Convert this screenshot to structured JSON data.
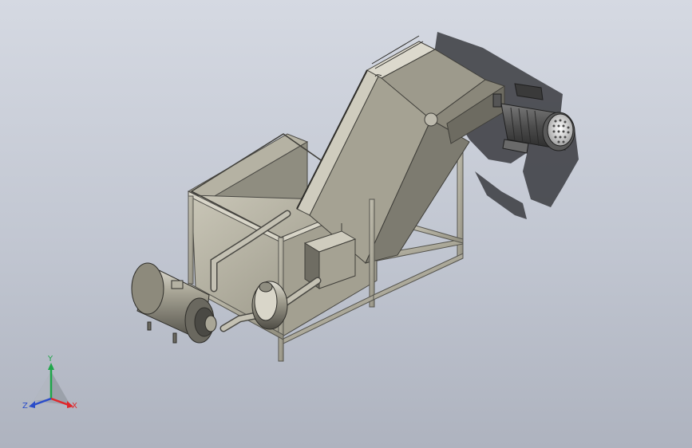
{
  "view": {
    "background_top": "#d5d9e2",
    "background_bottom": "#aeb3bf",
    "steel_color": "#a9a594",
    "steel_dark_color": "#6f6d63",
    "shadow_color": "#3a3b40"
  },
  "triad": {
    "x_label": "X",
    "y_label": "Y",
    "z_label": "Z",
    "x_color": "#e0262a",
    "y_color": "#1fa64a",
    "z_color": "#2a4cc9"
  }
}
